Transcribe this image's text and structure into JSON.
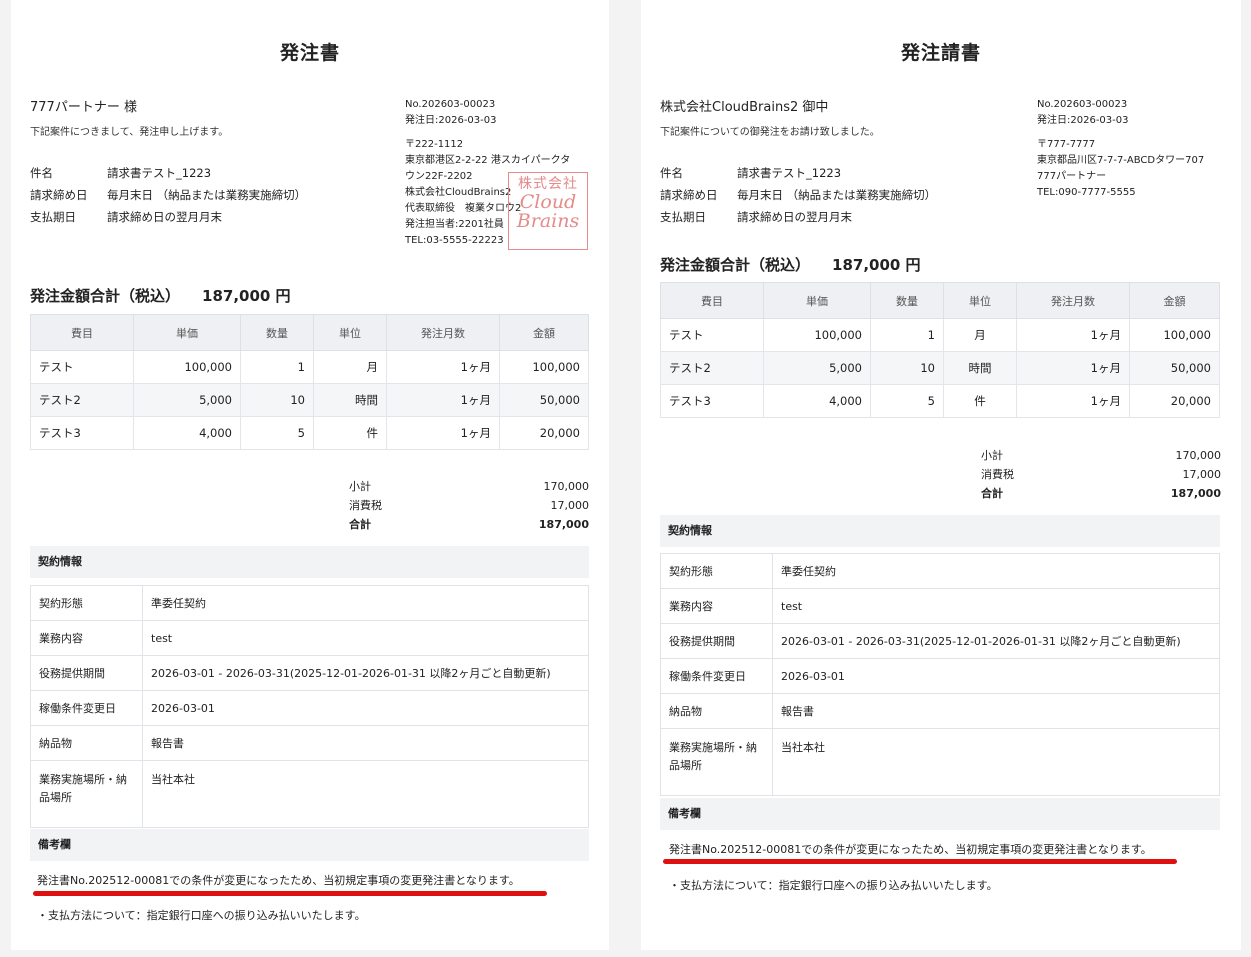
{
  "left": {
    "title": "発注書",
    "recipient": "777パートナー 様",
    "intro": "下記案件につきまして、発注申し上げます。",
    "fields": [
      {
        "k": "件名",
        "v": "請求書テスト_1223"
      },
      {
        "k": "請求締め日",
        "v": "毎月末日 （納品または業務実施締切）"
      },
      {
        "k": "支払期日",
        "v": "請求締め日の翌月月末"
      }
    ],
    "issuer": {
      "no": "No.202603-00023",
      "date": "発注日:2026-03-03",
      "zip": "〒222-1112",
      "addr1": "東京都港区2-2-22 港スカイパークタ",
      "addr2": "ウン22F-2202",
      "company": "株式会社CloudBrains2",
      "rep": "代表取締役　複業タロウ2",
      "person": "発注担当者:2201社員",
      "tel": "TEL:03-5555-22223"
    },
    "stamp": {
      "line1": "株式会社",
      "line2": "Cloud",
      "line3": "Brains"
    },
    "total": {
      "label": "発注金額合計（税込）",
      "amount": "187,000 円"
    },
    "table_headers": [
      "費目",
      "単価",
      "数量",
      "単位",
      "発注月数",
      "金額"
    ],
    "rows": [
      [
        "テスト",
        "100,000",
        "1",
        "月",
        "1ヶ月",
        "100,000"
      ],
      [
        "テスト2",
        "5,000",
        "10",
        "時間",
        "1ヶ月",
        "50,000"
      ],
      [
        "テスト3",
        "4,000",
        "5",
        "件",
        "1ヶ月",
        "20,000"
      ]
    ],
    "sums": [
      {
        "k": "小計",
        "v": "170,000"
      },
      {
        "k": "消費税",
        "v": "17,000"
      },
      {
        "k": "合計",
        "v": "187,000"
      }
    ],
    "contract_title": "契約情報",
    "contract": [
      {
        "k": "契約形態",
        "v": "準委任契約"
      },
      {
        "k": "業務内容",
        "v": "test"
      },
      {
        "k": "役務提供期間",
        "v": "2026-03-01 - 2026-03-31(2025-12-01-2026-01-31 以降2ヶ月ごと自動更新)"
      },
      {
        "k": "稼働条件変更日",
        "v": "2026-03-01"
      },
      {
        "k": "納品物",
        "v": "報告書"
      },
      {
        "k": "業務実施場所・納品場所",
        "v": "当社本社"
      }
    ],
    "remarks_title": "備考欄",
    "remark1": "発注書No.202512-00081での条件が変更になったため、当初規定事項の変更発注書となります。",
    "remark2": "・支払方法について：指定銀行口座への振り込み払いいたします。"
  },
  "right": {
    "title": "発注請書",
    "recipient": "株式会社CloudBrains2 御中",
    "intro": "下記案件についての御発注をお請け致しました。",
    "fields": [
      {
        "k": "件名",
        "v": "請求書テスト_1223"
      },
      {
        "k": "請求締め日",
        "v": "毎月末日 （納品または業務実施締切）"
      },
      {
        "k": "支払期日",
        "v": "請求締め日の翌月月末"
      }
    ],
    "issuer": {
      "no": "No.202603-00023",
      "date": "発注日:2026-03-03",
      "zip": "〒777-7777",
      "addr1": "東京都品川区7-7-7-ABCDタワー707",
      "name": "777パートナー",
      "tel": "TEL:090-7777-5555"
    },
    "total": {
      "label": "発注金額合計（税込）",
      "amount": "187,000 円"
    },
    "table_headers": [
      "費目",
      "単価",
      "数量",
      "単位",
      "発注月数",
      "金額"
    ],
    "rows": [
      [
        "テスト",
        "100,000",
        "1",
        "月",
        "1ヶ月",
        "100,000"
      ],
      [
        "テスト2",
        "5,000",
        "10",
        "時間",
        "1ヶ月",
        "50,000"
      ],
      [
        "テスト3",
        "4,000",
        "5",
        "件",
        "1ヶ月",
        "20,000"
      ]
    ],
    "sums": [
      {
        "k": "小計",
        "v": "170,000"
      },
      {
        "k": "消費税",
        "v": "17,000"
      },
      {
        "k": "合計",
        "v": "187,000"
      }
    ],
    "contract_title": "契約情報",
    "contract": [
      {
        "k": "契約形態",
        "v": "準委任契約"
      },
      {
        "k": "業務内容",
        "v": "test"
      },
      {
        "k": "役務提供期間",
        "v": "2026-03-01 - 2026-03-31(2025-12-01-2026-01-31 以降2ヶ月ごと自動更新)"
      },
      {
        "k": "稼働条件変更日",
        "v": "2026-03-01"
      },
      {
        "k": "納品物",
        "v": "報告書"
      },
      {
        "k": "業務実施場所・納品場所",
        "v": "当社本社"
      }
    ],
    "remarks_title": "備考欄",
    "remark1": "発注書No.202512-00081での条件が変更になったため、当初規定事項の変更発注書となります。",
    "remark2": "・支払方法について：指定銀行口座への振り込み払いいたします。"
  }
}
